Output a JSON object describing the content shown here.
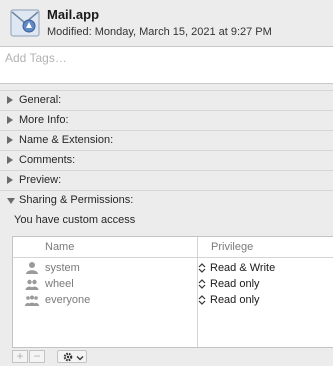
{
  "header": {
    "title": "Mail.app",
    "modified": "Modified: Monday, March 15, 2021 at 9:27 PM",
    "icon": "mail-app-icon"
  },
  "tags": {
    "placeholder": "Add Tags…",
    "value": ""
  },
  "sections": [
    {
      "label": "General:",
      "expanded": false
    },
    {
      "label": "More Info:",
      "expanded": false
    },
    {
      "label": "Name & Extension:",
      "expanded": false
    },
    {
      "label": "Comments:",
      "expanded": false
    },
    {
      "label": "Preview:",
      "expanded": false
    },
    {
      "label": "Sharing & Permissions:",
      "expanded": true
    }
  ],
  "sharing": {
    "access_text": "You have custom access",
    "columns": {
      "name": "Name",
      "privilege": "Privilege"
    },
    "rows": [
      {
        "name": "system",
        "privilege": "Read & Write",
        "icon": "single-user-icon"
      },
      {
        "name": "wheel",
        "privilege": "Read only",
        "icon": "group-icon"
      },
      {
        "name": "everyone",
        "privilege": "Read only",
        "icon": "everyone-icon"
      }
    ]
  },
  "toolbar": {
    "add": "+",
    "remove": "−",
    "action_icon": "gear-icon"
  }
}
